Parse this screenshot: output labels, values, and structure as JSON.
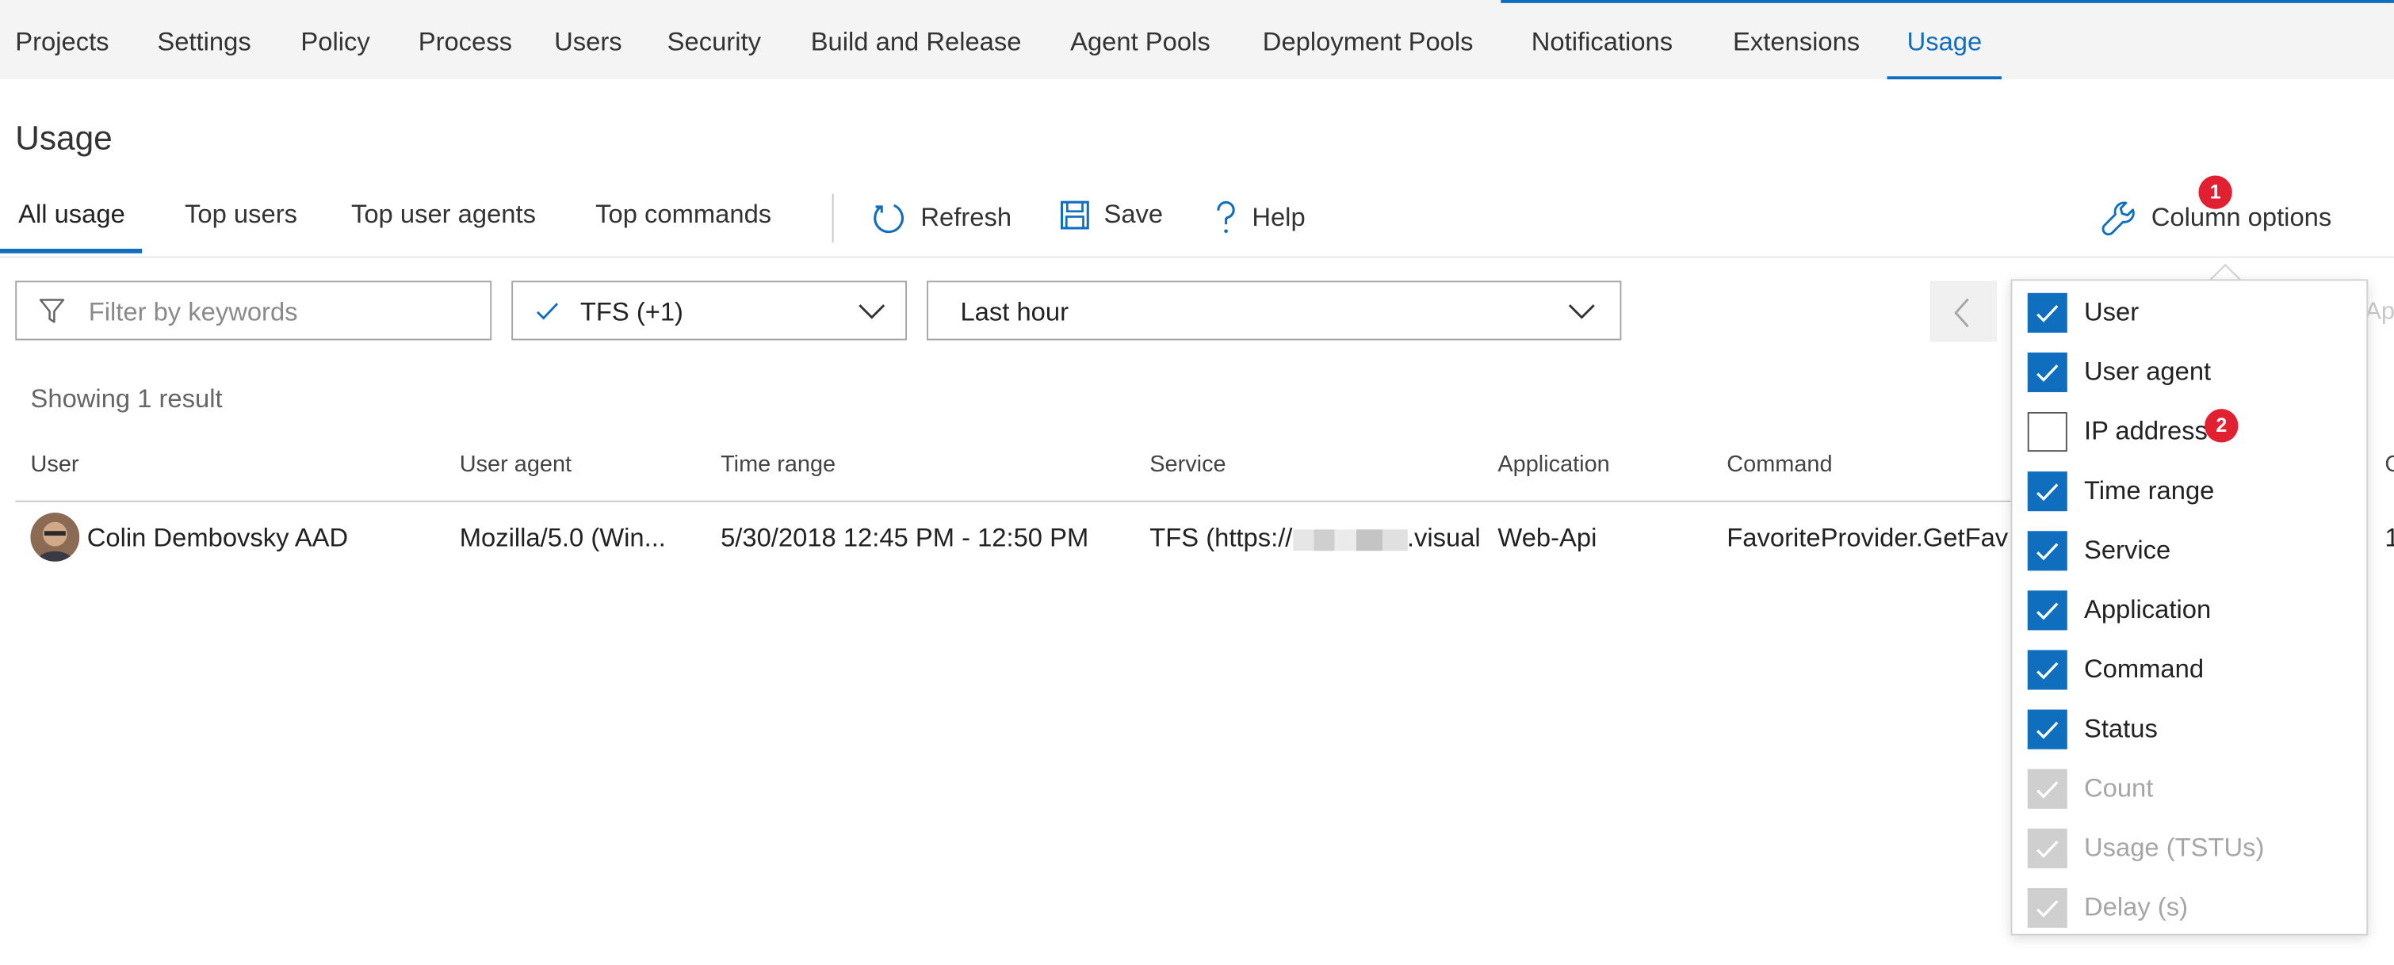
{
  "nav": {
    "items": [
      {
        "label": "Projects"
      },
      {
        "label": "Settings"
      },
      {
        "label": "Policy"
      },
      {
        "label": "Process"
      },
      {
        "label": "Users"
      },
      {
        "label": "Security"
      },
      {
        "label": "Build and Release"
      },
      {
        "label": "Agent Pools"
      },
      {
        "label": "Deployment Pools"
      },
      {
        "label": "Notifications"
      },
      {
        "label": "Extensions"
      },
      {
        "label": "Usage",
        "active": true
      }
    ]
  },
  "page": {
    "title": "Usage"
  },
  "tabs": [
    {
      "label": "All usage",
      "active": true
    },
    {
      "label": "Top users"
    },
    {
      "label": "Top user agents"
    },
    {
      "label": "Top commands"
    }
  ],
  "toolbar": {
    "refresh_label": "Refresh",
    "save_label": "Save",
    "help_label": "Help",
    "column_options_label": "Column options"
  },
  "badges": {
    "column_options": "1",
    "ip_address": "2"
  },
  "filters": {
    "keyword_placeholder": "Filter by keywords",
    "service_value": "TFS (+1)",
    "time_value": "Last hour"
  },
  "pager": {
    "next_label_fragment": "Ap"
  },
  "results": {
    "summary": "Showing 1 result"
  },
  "table": {
    "columns": [
      "User",
      "User agent",
      "Time range",
      "Service",
      "Application",
      "Command"
    ],
    "cut_column_fragment": "C",
    "rows": [
      {
        "user": "Colin Dembovsky AAD",
        "user_agent": "Mozilla/5.0 (Win...",
        "time_range": "5/30/2018 12:45 PM - 12:50 PM",
        "service": "TFS (https://",
        "service_suffix": ".visual",
        "application": "Web-Api",
        "command": "FavoriteProvider.GetFav",
        "cut_fragment": "1"
      }
    ]
  },
  "column_options": {
    "items": [
      {
        "label": "User",
        "state": "checked"
      },
      {
        "label": "User agent",
        "state": "checked"
      },
      {
        "label": "IP address",
        "state": "unchecked"
      },
      {
        "label": "Time range",
        "state": "checked"
      },
      {
        "label": "Service",
        "state": "checked"
      },
      {
        "label": "Application",
        "state": "checked"
      },
      {
        "label": "Command",
        "state": "checked"
      },
      {
        "label": "Status",
        "state": "checked"
      },
      {
        "label": "Count",
        "state": "disabled"
      },
      {
        "label": "Usage (TSTUs)",
        "state": "disabled"
      },
      {
        "label": "Delay (s)",
        "state": "disabled"
      }
    ]
  },
  "colors": {
    "accent": "#106ebe",
    "badge": "#e12131",
    "disabled_check": "#cfcfcf"
  }
}
